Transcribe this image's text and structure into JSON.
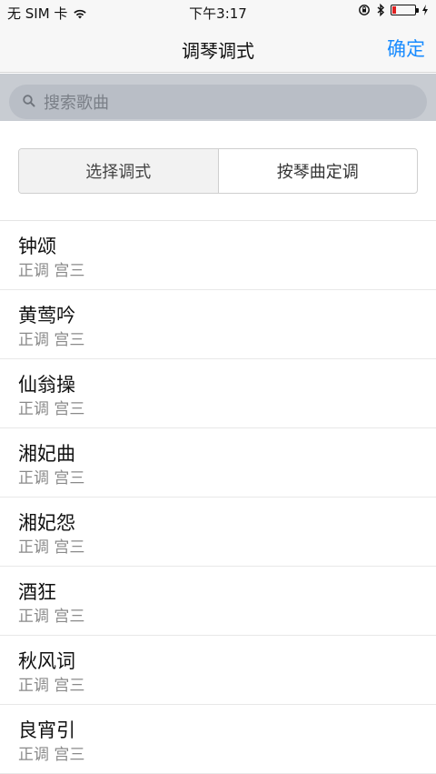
{
  "status": {
    "carrier": "无 SIM 卡",
    "time": "下午3:17"
  },
  "nav": {
    "title": "调琴调式",
    "confirm": "确定"
  },
  "search": {
    "placeholder": "搜索歌曲"
  },
  "segments": [
    {
      "label": "选择调式",
      "active": true
    },
    {
      "label": "按琴曲定调",
      "active": false
    }
  ],
  "songs": [
    {
      "name": "钟颂",
      "mode": "正调 宫三"
    },
    {
      "name": "黄莺吟",
      "mode": "正调 宫三"
    },
    {
      "name": "仙翁操",
      "mode": "正调 宫三"
    },
    {
      "name": "湘妃曲",
      "mode": "正调 宫三"
    },
    {
      "name": "湘妃怨",
      "mode": "正调 宫三"
    },
    {
      "name": "酒狂",
      "mode": "正调 宫三"
    },
    {
      "name": "秋风词",
      "mode": "正调 宫三"
    },
    {
      "name": "良宵引",
      "mode": "正调 宫三"
    }
  ],
  "colors": {
    "accent": "#1a8cff",
    "battery_low": "#e02020"
  }
}
